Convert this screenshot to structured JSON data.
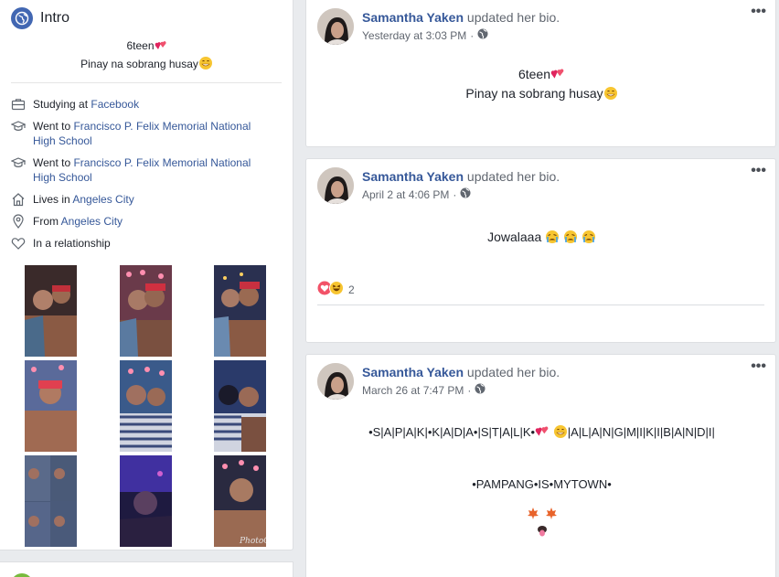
{
  "intro": {
    "title": "Intro",
    "bio_line1": "6teen",
    "bio_line2": "Pinay na sobrang husay",
    "items": [
      {
        "prefix": "Studying at ",
        "link": "Facebook",
        "icon": "briefcase-icon"
      },
      {
        "prefix": "Went to ",
        "link": "Francisco P. Felix Memorial National High School",
        "icon": "graduation-cap-icon"
      },
      {
        "prefix": "Went to ",
        "link": "Francisco P. Felix Memorial National High School",
        "icon": "graduation-cap-icon"
      },
      {
        "prefix": "Lives in ",
        "link": "Angeles City",
        "icon": "home-icon"
      },
      {
        "prefix": "From ",
        "link": "Angeles City",
        "icon": "map-pin-icon"
      },
      {
        "prefix": "In a relationship",
        "link": "",
        "icon": "heart-icon"
      }
    ],
    "photo_watermark": "PhotoGrid"
  },
  "posts": [
    {
      "author": "Samantha Yaken",
      "action": "updated her bio.",
      "timestamp": "Yesterday at 3:03 PM",
      "more": "•••",
      "body_line1": "6teen",
      "body_line2": "Pinay na sobrang husay"
    },
    {
      "author": "Samantha Yaken",
      "action": "updated her bio.",
      "timestamp": "April 2 at 4:06 PM",
      "more": "•••",
      "body_line1": "Jowalaaa",
      "reaction_count": "2"
    },
    {
      "author": "Samantha Yaken",
      "action": "updated her bio.",
      "timestamp": "March 26 at 7:47 PM",
      "more": "•••",
      "body_line1_a": "•S|A|P|A|K|•K|A|D|A•|S|T|A|L|K•",
      "body_line1_b": "|A|L|A|N|G|M|I|K|I|B|A|N|D|I|",
      "body_line2": "•PAMPANG•IS•MYTOWN•"
    }
  ],
  "colors": {
    "link": "#365899",
    "brand": "#4267b2",
    "meta": "#616770",
    "background": "#e9ebee",
    "green": "#78bb3e"
  }
}
